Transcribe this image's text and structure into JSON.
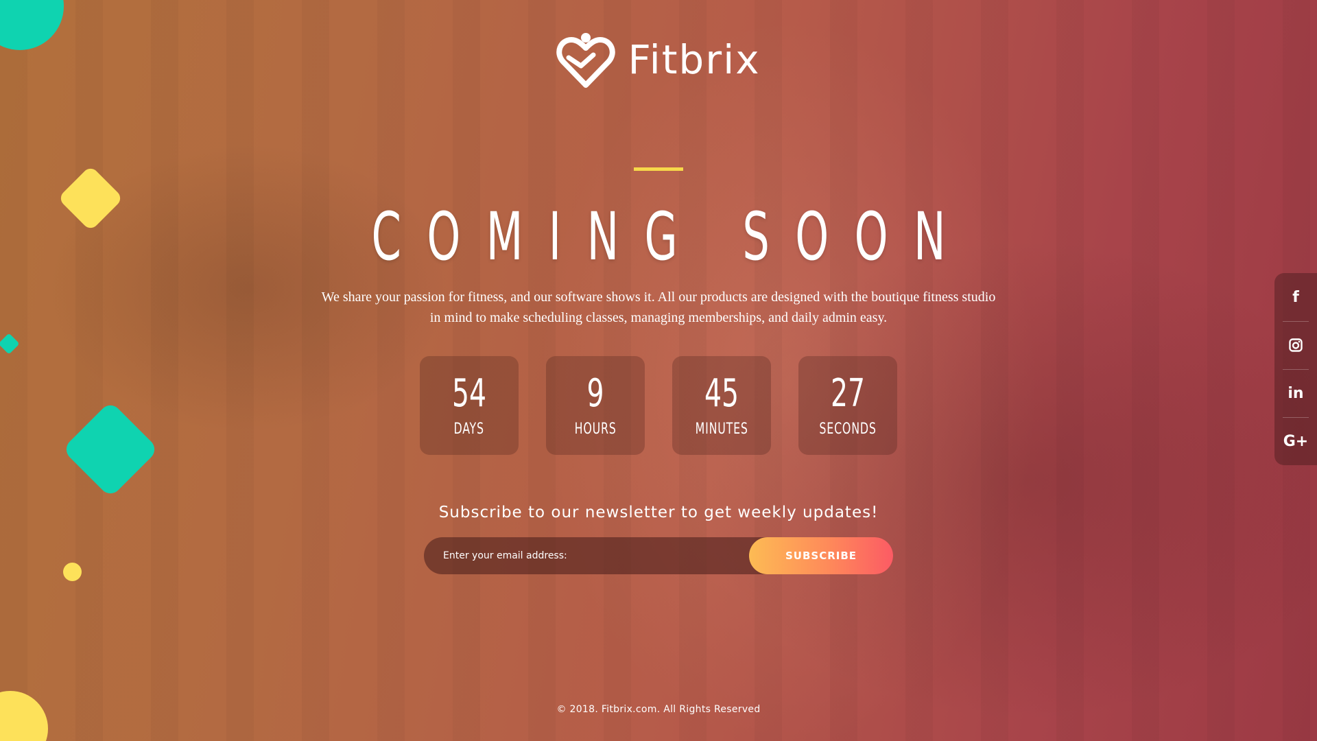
{
  "brand": {
    "name": "Fitbrix",
    "logo_icon": "heart-person-icon"
  },
  "hero": {
    "headline": "COMING SOON",
    "description": "We share your passion for fitness, and our software shows it. All our products are designed with the boutique fitness studio in mind to make scheduling classes, managing memberships, and daily admin easy."
  },
  "countdown": [
    {
      "value": "54",
      "unit": "DAYS"
    },
    {
      "value": "9",
      "unit": "HOURS"
    },
    {
      "value": "45",
      "unit": "MINUTES"
    },
    {
      "value": "27",
      "unit": "SECONDS"
    }
  ],
  "newsletter": {
    "title": "Subscribe to our newsletter to get weekly updates!",
    "placeholder": "Enter your email address:",
    "button_label": "SUBSCRIBE"
  },
  "social": [
    {
      "icon": "facebook-icon",
      "glyph": "f"
    },
    {
      "icon": "instagram-icon",
      "glyph": ""
    },
    {
      "icon": "linkedin-icon",
      "glyph": "in"
    },
    {
      "icon": "google-plus-icon",
      "glyph": "G+"
    }
  ],
  "footer": {
    "copyright": "© 2018. Fitbrix.com. All Rights Reserved"
  },
  "colors": {
    "accent_teal": "#0fd3b0",
    "accent_yellow": "#fde15a",
    "button_gradient_start": "#fdbb54",
    "button_gradient_end": "#fc5b64",
    "background_warm": "#b2703c",
    "background_red": "#9c3a44"
  }
}
